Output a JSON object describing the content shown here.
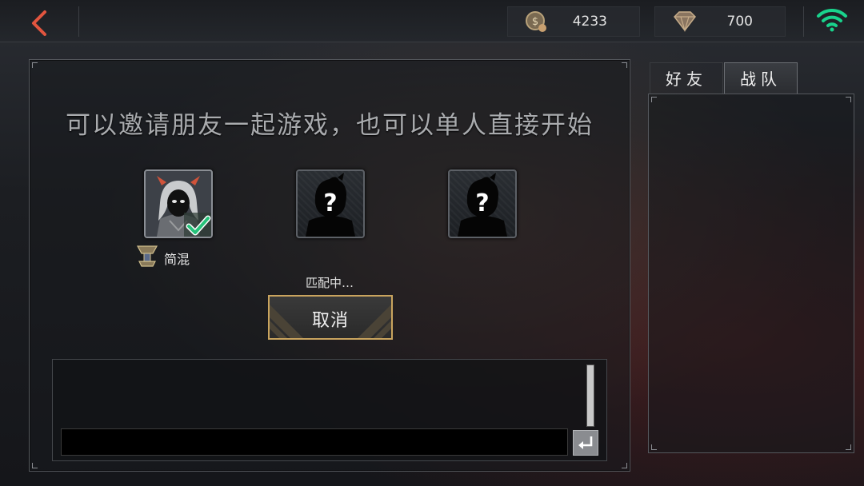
{
  "topbar": {
    "coins": "4233",
    "gems": "700"
  },
  "main": {
    "headline": "可以邀请朋友一起游戏，也可以单人直接开始",
    "players": [
      {
        "name": "简混",
        "status": "ready"
      },
      {
        "name": "",
        "status": "empty"
      },
      {
        "name": "",
        "status": "empty"
      }
    ],
    "matching_text": "匹配中…",
    "cancel_label": "取消"
  },
  "chat": {
    "input_value": "",
    "input_placeholder": ""
  },
  "side": {
    "tabs": [
      {
        "label": "好友",
        "active": false
      },
      {
        "label": "战队",
        "active": true
      }
    ]
  },
  "colors": {
    "accent_gold": "#c9a45e",
    "back_arrow": "#e2553f",
    "wifi": "#19d38c",
    "check": "#27c27a"
  },
  "icons": [
    "back-arrow-icon",
    "coin-icon",
    "gem-icon",
    "wifi-icon",
    "rank-badge-icon",
    "check-icon",
    "unknown-player-icon",
    "enter-icon"
  ]
}
